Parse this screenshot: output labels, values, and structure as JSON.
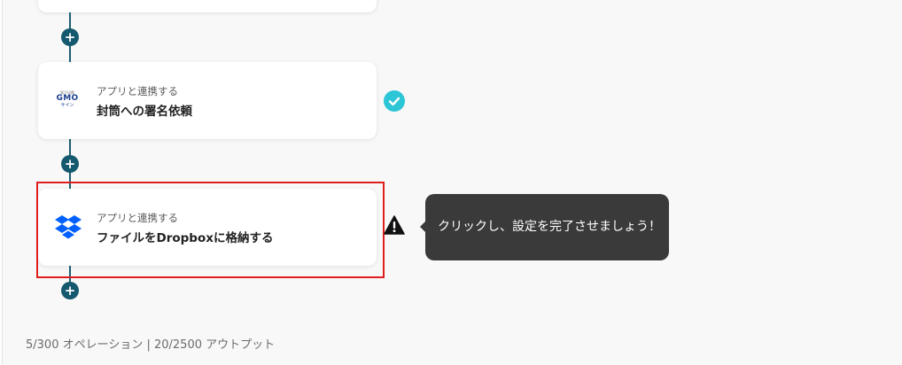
{
  "flow": {
    "add_step_symbol": "+",
    "steps": [
      {
        "subtitle": "アプリと連携する",
        "title": "封筒への署名依頼",
        "app_icon": "gmo-sign-logo",
        "logo_text_top": "電子印鑑",
        "logo_text_main": "GMO",
        "logo_text_bottom": "サイン",
        "status_icon": "check-circle-icon"
      },
      {
        "subtitle": "アプリと連携する",
        "title": "ファイルをDropboxに格納する",
        "app_icon": "dropbox-icon",
        "status_icon": "warning-icon"
      }
    ]
  },
  "tooltip": {
    "text": "クリックし、設定を完了させましょう！"
  },
  "footer": {
    "usage_text": "5/300 オペレーション | 20/2500 アウトプット"
  },
  "colors": {
    "accent": "#15596e",
    "check": "#2cc6d6",
    "highlight": "#e01e1e",
    "dropbox": "#0061fe",
    "tooltip_bg": "#3a3a3a"
  }
}
